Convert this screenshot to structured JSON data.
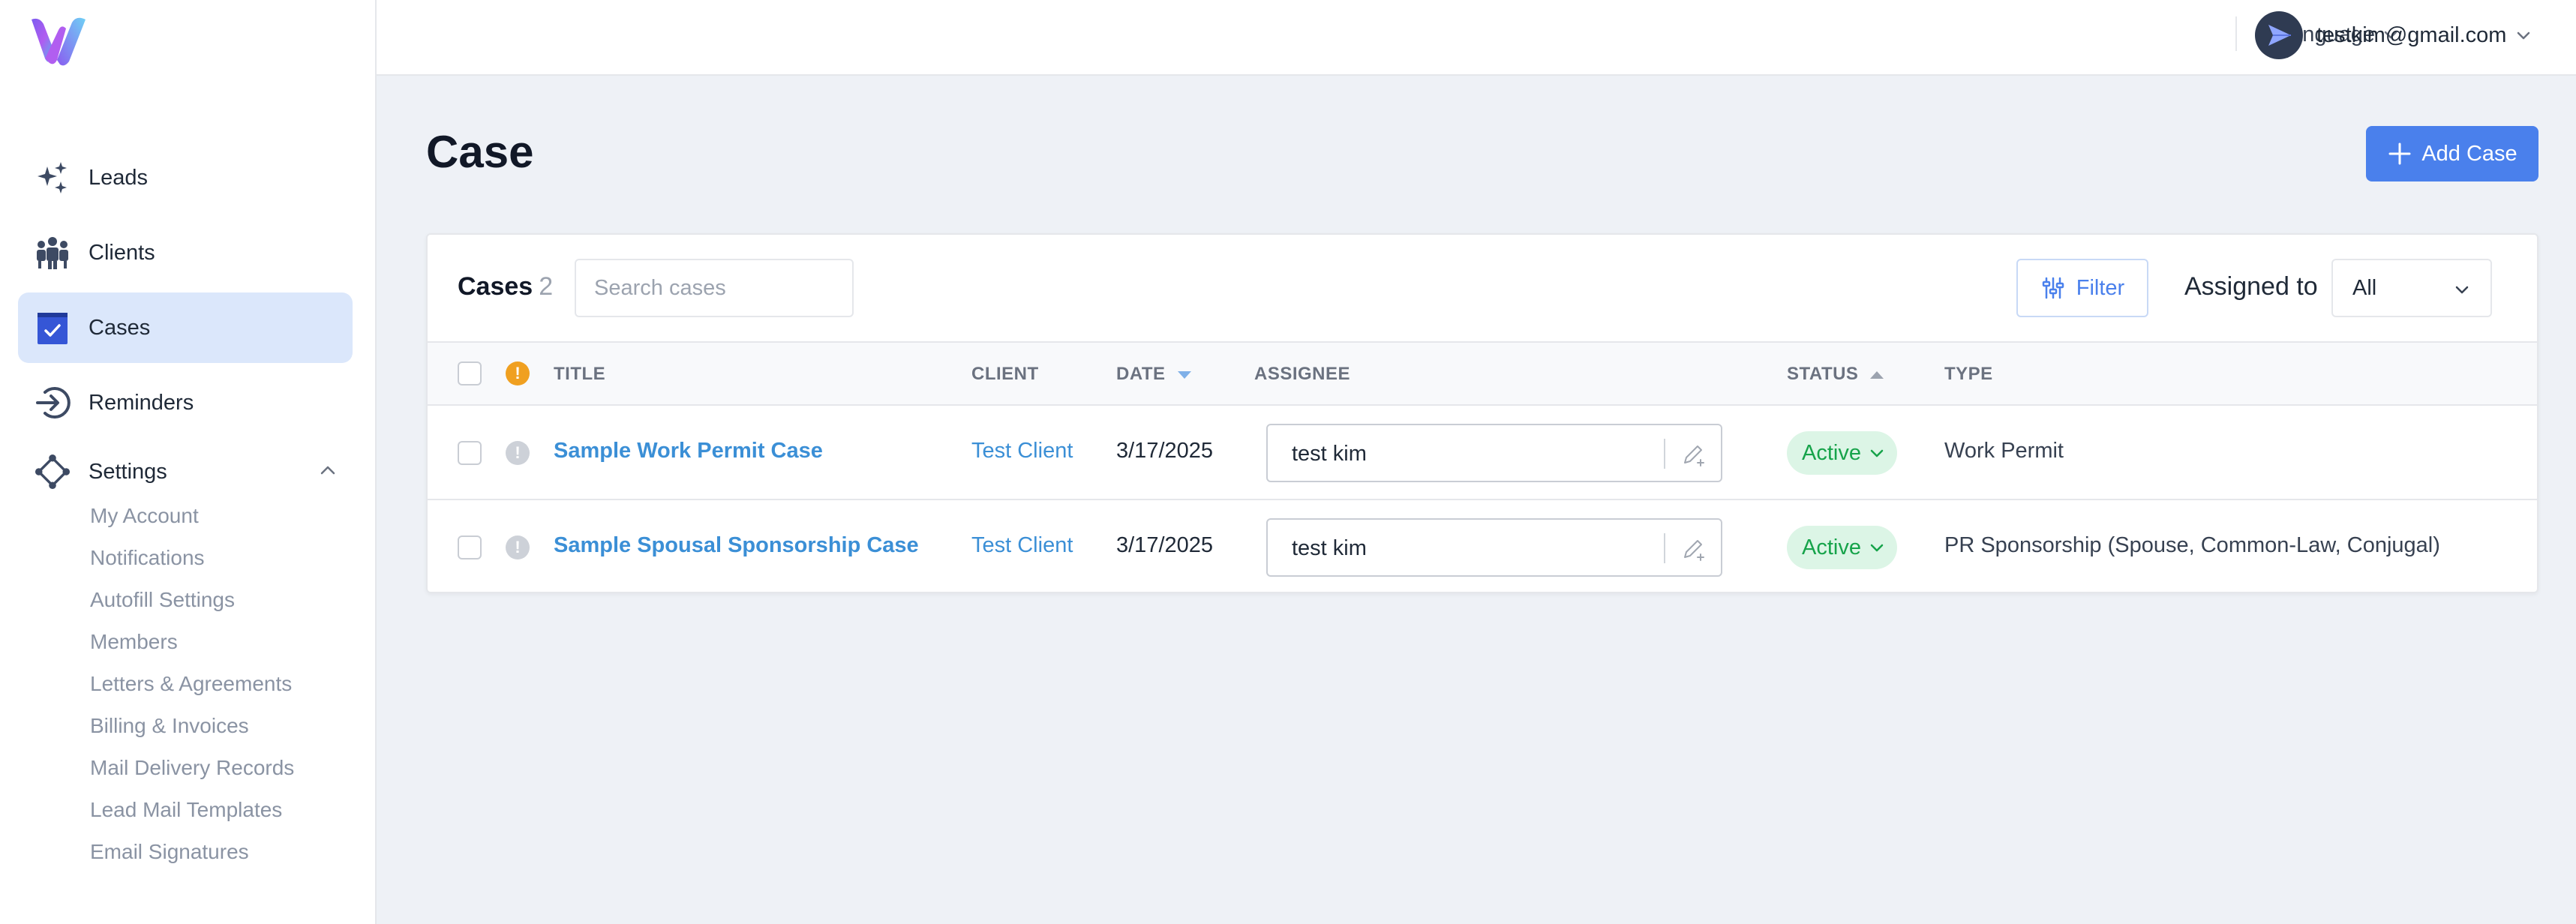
{
  "sidebar": {
    "nav": [
      {
        "label": "Leads",
        "icon": "sparkles-icon"
      },
      {
        "label": "Clients",
        "icon": "people-icon"
      },
      {
        "label": "Cases",
        "icon": "clipboard-check-icon"
      },
      {
        "label": "Reminders",
        "icon": "login-arrow-icon"
      },
      {
        "label": "Settings",
        "icon": "nodes-icon"
      }
    ],
    "settings_items": [
      "My Account",
      "Notifications",
      "Autofill Settings",
      "Members",
      "Letters & Agreements",
      "Billing & Invoices",
      "Mail Delivery Records",
      "Lead Mail Templates",
      "Email Signatures"
    ]
  },
  "topbar": {
    "language_label": "Language",
    "user_email": "testkim@gmail.com"
  },
  "page": {
    "title": "Case",
    "add_button_label": "Add Case"
  },
  "toolbar": {
    "cases_label": "Cases",
    "cases_count": "2",
    "search_placeholder": "Search cases",
    "filter_label": "Filter",
    "assigned_label": "Assigned to",
    "assigned_value": "All"
  },
  "table": {
    "headers": {
      "title": "TITLE",
      "client": "CLIENT",
      "date": "DATE",
      "assignee": "ASSIGNEE",
      "status": "STATUS",
      "type": "TYPE"
    },
    "rows": [
      {
        "title": "Sample Work Permit Case",
        "client": "Test Client",
        "date": "3/17/2025",
        "assignee": "test kim",
        "status": "Active",
        "type": "Work Permit"
      },
      {
        "title": "Sample Spousal Sponsorship Case",
        "client": "Test Client",
        "date": "3/17/2025",
        "assignee": "test kim",
        "status": "Active",
        "type": "PR Sponsorship (Spouse, Common-Law, Conjugal)"
      }
    ]
  },
  "colors": {
    "accent": "#4a80ec",
    "link": "#3b8fd6",
    "active_nav_bg": "#dbe7fb",
    "status_active_bg": "#dcf5e6",
    "status_active_text": "#16a34a",
    "warning": "#f0a020"
  }
}
